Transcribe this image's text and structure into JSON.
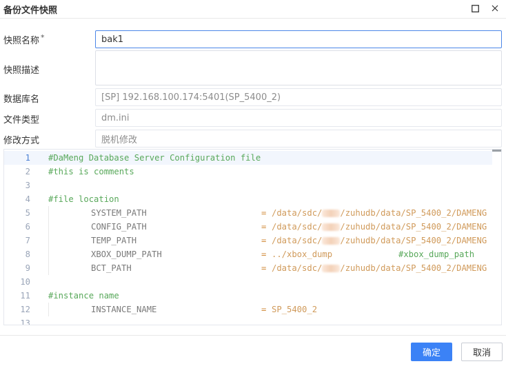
{
  "dialog": {
    "title": "备份文件快照"
  },
  "form": {
    "snapshot_name_label": "快照名称",
    "required_mark": "*",
    "snapshot_name_value": "bak1",
    "snapshot_desc_label": "快照描述",
    "snapshot_desc_value": "",
    "database_label": "数据库名",
    "database_value": "[SP] 192.168.100.174:5401(SP_5400_2)",
    "file_type_label": "文件类型",
    "file_type_value": "dm.ini",
    "modify_mode_label": "修改方式",
    "modify_mode_value": "脱机修改"
  },
  "editor": {
    "lines": [
      {
        "num": "1",
        "comment": "#DaMeng Database Server Configuration file"
      },
      {
        "num": "2",
        "comment": "#this is comments"
      },
      {
        "num": "3"
      },
      {
        "num": "4",
        "comment": "#file location"
      },
      {
        "num": "5",
        "key": "SYSTEM_PATH",
        "eq": "=",
        "val_a": "/data/sdc/",
        "val_b": "/zuhudb/data/SP_5400_2/DAMENG"
      },
      {
        "num": "6",
        "key": "CONFIG_PATH",
        "eq": "=",
        "val_a": "/data/sdc/",
        "val_b": "/zuhudb/data/SP_5400_2/DAMENG"
      },
      {
        "num": "7",
        "key": "TEMP_PATH",
        "eq": "=",
        "val_a": "/data/sdc/",
        "val_b": "/zuhudb/data/SP_5400_2/DAMENG"
      },
      {
        "num": "8",
        "key": "XBOX_DUMP_PATH",
        "eq": "=",
        "val": "../xbox_dump",
        "comment": "#xbox_dump_path"
      },
      {
        "num": "9",
        "key": "BCT_PATH",
        "eq": "=",
        "val_a": "/data/sdc/",
        "val_b": "/zuhudb/data/SP_5400_2/DAMENG"
      },
      {
        "num": "10"
      },
      {
        "num": "11",
        "comment": "#instance name"
      },
      {
        "num": "12",
        "key": "INSTANCE_NAME",
        "eq": "=",
        "val": "SP_5400_2"
      },
      {
        "num": "13"
      }
    ]
  },
  "footer": {
    "confirm_label": "确定",
    "cancel_label": "取消"
  },
  "icons": {
    "maximize": "maximize-icon",
    "close": "close-icon"
  },
  "colors": {
    "primary": "#3b82f6",
    "comment": "#58a85a",
    "value": "#d09a5a"
  }
}
